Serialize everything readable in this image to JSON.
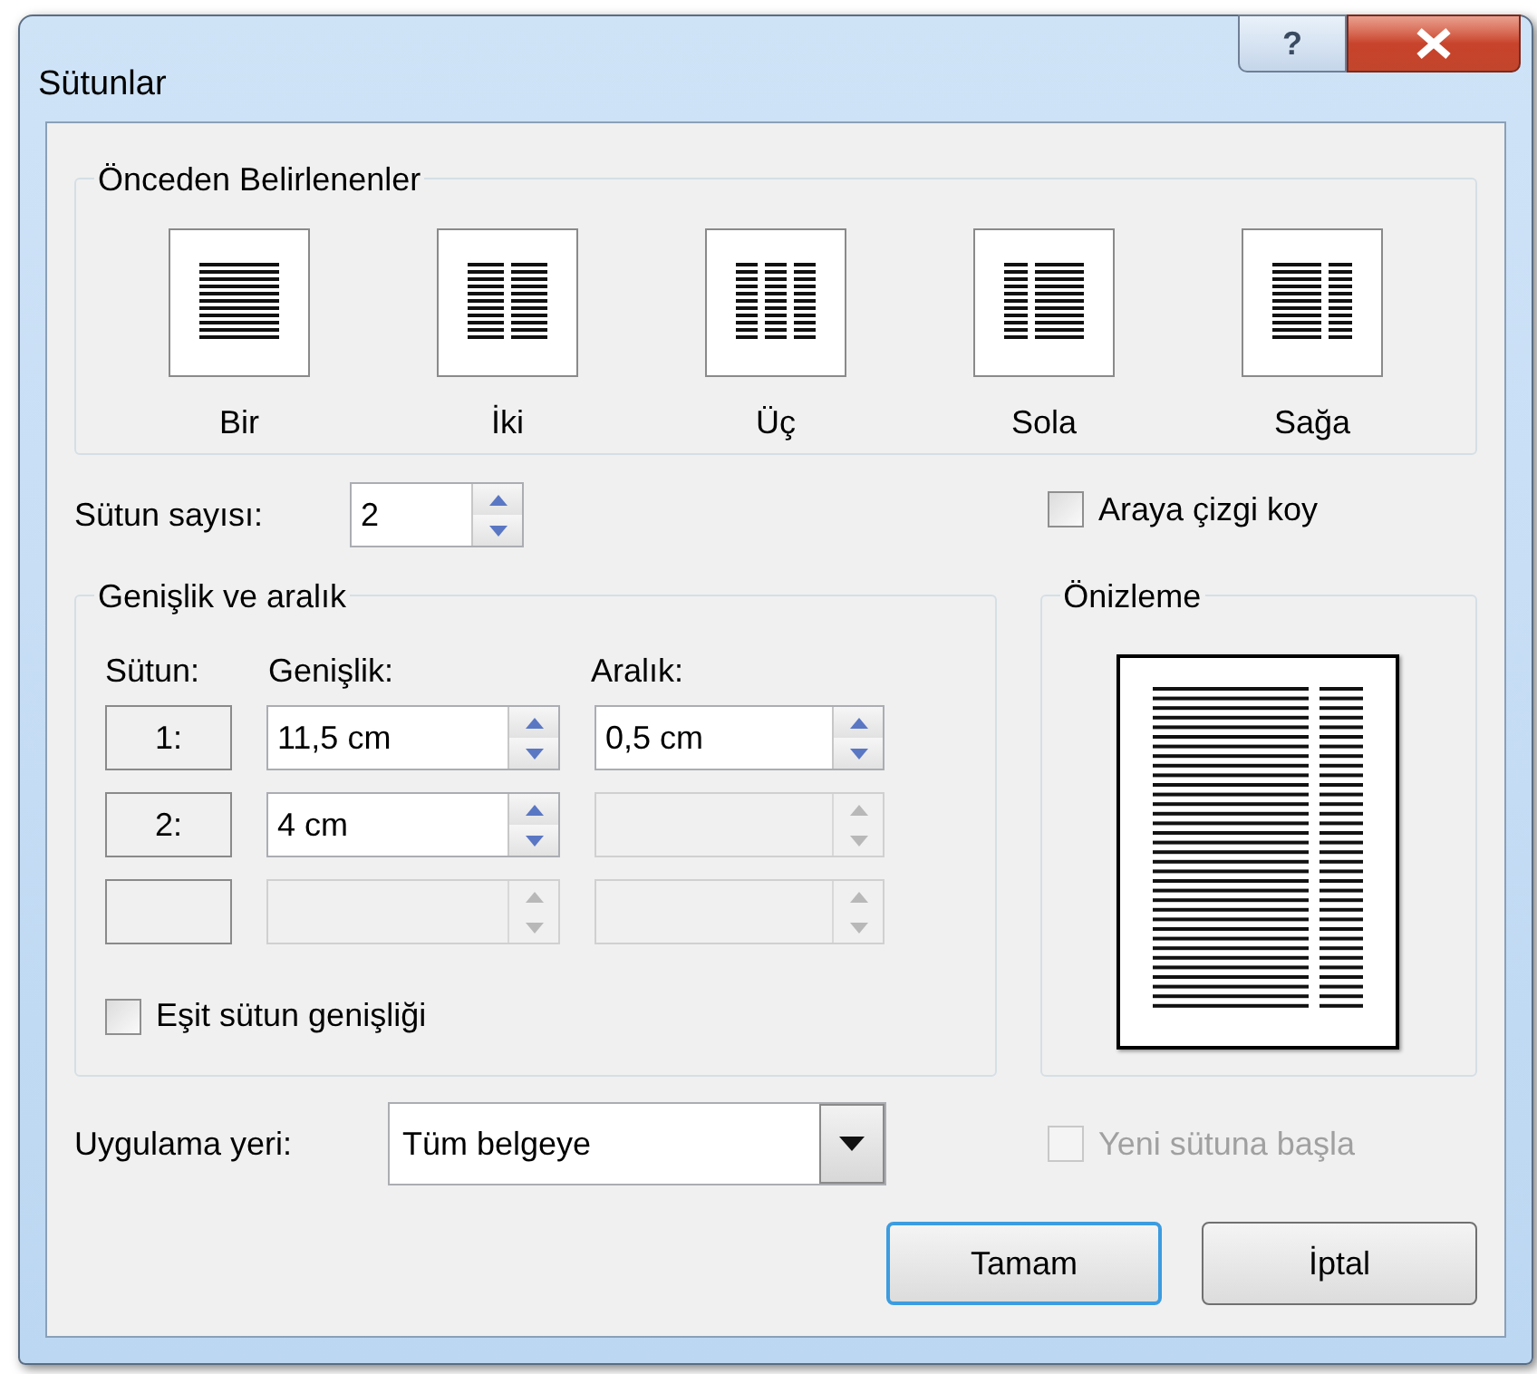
{
  "window": {
    "title": "Sütunlar",
    "help_button": "?"
  },
  "presets": {
    "title": "Önceden Belirlenenler",
    "items": [
      {
        "label": "Bir",
        "kind": "one"
      },
      {
        "label": "İki",
        "kind": "two"
      },
      {
        "label": "Üç",
        "kind": "three"
      },
      {
        "label": "Sola",
        "kind": "left"
      },
      {
        "label": "Sağa",
        "kind": "right"
      }
    ]
  },
  "column_count": {
    "label": "Sütun sayısı:",
    "value": "2"
  },
  "line_between": {
    "label": "Araya çizgi koy",
    "checked": false
  },
  "width_spacing": {
    "title": "Genişlik ve aralık",
    "headers": [
      "Sütun:",
      "Genişlik:",
      "Aralık:"
    ],
    "rows": [
      {
        "number": "1:",
        "width": "11,5 cm",
        "spacing": "0,5 cm",
        "width_disabled": false,
        "spacing_disabled": false
      },
      {
        "number": "2:",
        "width": "4 cm",
        "width_disabled": false,
        "spacing_disabled": true
      },
      {
        "width_disabled": true,
        "spacing_disabled": true
      }
    ],
    "equal_width": {
      "label": "Eşit sütun genişliği",
      "checked": false
    }
  },
  "preview": {
    "title": "Önizleme"
  },
  "apply_to": {
    "label": "Uygulama yeri:",
    "value": "Tüm belgeye"
  },
  "new_column": {
    "label": "Yeni sütuna başla",
    "checked": false,
    "disabled": true
  },
  "buttons": [
    {
      "label": "Tamam",
      "default": true
    },
    {
      "label": "İptal",
      "default": false
    }
  ]
}
